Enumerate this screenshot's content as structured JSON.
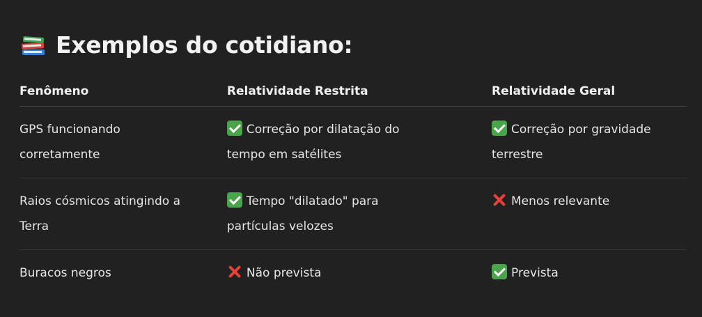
{
  "heading": {
    "icon": "books-icon",
    "title": "Exemplos do cotidiano:"
  },
  "table": {
    "headers": [
      "Fenômeno",
      "Relatividade Restrita",
      "Relatividade Geral"
    ],
    "rows": [
      {
        "phenomenon": "GPS funcionando corretamente",
        "restricted": {
          "mark": "check-icon",
          "text": "Correção por dilatação do tempo em satélites"
        },
        "general": {
          "mark": "check-icon",
          "text": "Correção por gravidade terrestre"
        }
      },
      {
        "phenomenon": "Raios cósmicos atingindo a Terra",
        "restricted": {
          "mark": "check-icon",
          "text": "Tempo \"dilatado\" para partículas velozes"
        },
        "general": {
          "mark": "cross-icon",
          "text": "Menos relevante"
        }
      },
      {
        "phenomenon": "Buracos negros",
        "restricted": {
          "mark": "cross-icon",
          "text": "Não prevista"
        },
        "general": {
          "mark": "check-icon",
          "text": "Prevista"
        }
      }
    ]
  },
  "colors": {
    "background": "#212121",
    "check": "#4aa54a",
    "cross": "#e8433a",
    "text": "#ececec"
  }
}
